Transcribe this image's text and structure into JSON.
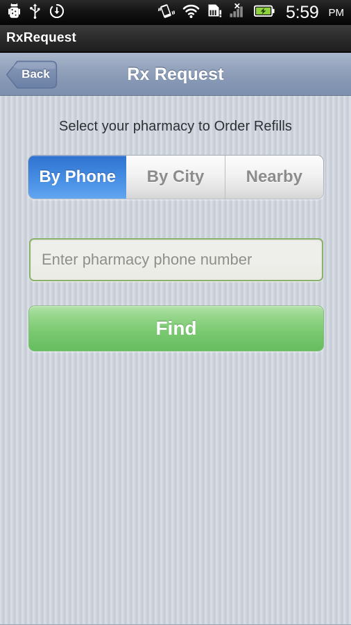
{
  "status_bar": {
    "icons_left": [
      "android-robot-icon",
      "usb-icon",
      "download-icon"
    ],
    "icons_right": [
      "vibrate-icon",
      "wifi-icon",
      "sd-card-alert-icon",
      "signal-no-service-icon",
      "battery-charging-icon"
    ],
    "time": "5:59",
    "ampm": "PM"
  },
  "app_bar": {
    "title": "RxRequest"
  },
  "nav_bar": {
    "back_label": "Back",
    "title": "Rx Request"
  },
  "main": {
    "instruction": "Select your pharmacy to Order Refills",
    "segments": [
      {
        "label": "By Phone",
        "active": true
      },
      {
        "label": "By City",
        "active": false
      },
      {
        "label": "Nearby",
        "active": false
      }
    ],
    "phone_input": {
      "value": "",
      "placeholder": "Enter pharmacy phone number"
    },
    "find_button": {
      "label": "Find"
    }
  },
  "colors": {
    "status_bar_bg": "#141414",
    "app_bar_bg": "#2b2b2b",
    "nav_bar_bg": "#8d9cb8",
    "page_bg": "#ccd2dc",
    "segment_active_blue": "#3d84dd",
    "segment_inactive_text": "#8c8c8c",
    "input_border_green": "#8bb26a",
    "find_button_green": "#78c86f",
    "battery_green": "#8fd13f"
  }
}
